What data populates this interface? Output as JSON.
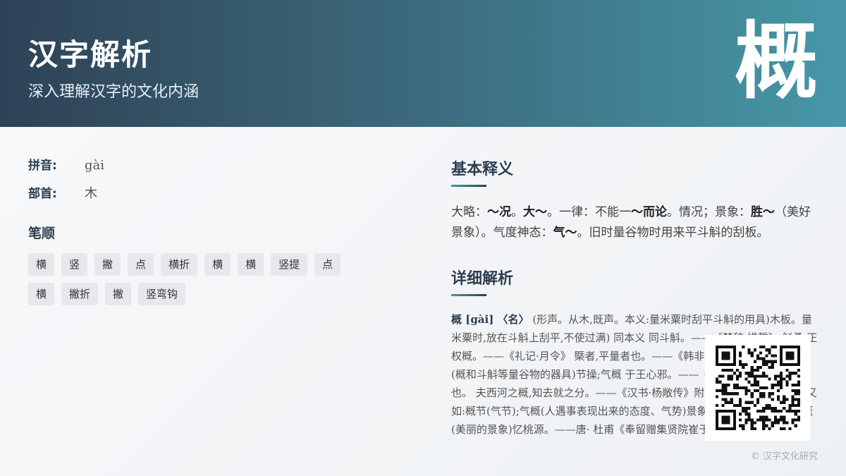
{
  "header": {
    "title": "汉字解析",
    "subtitle": "深入理解汉字的文化内涵",
    "character": "概"
  },
  "info": {
    "pinyin_label": "拼音:",
    "pinyin_value": "gài",
    "radical_label": "部首:",
    "radical_value": "木"
  },
  "strokes": {
    "title": "笔顺",
    "items": [
      "横",
      "竖",
      "撇",
      "点",
      "横折",
      "横",
      "横",
      "竖提",
      "点",
      "横",
      "撇折",
      "撇",
      "竖弯钩"
    ]
  },
  "basic": {
    "title": "基本释义",
    "segments": [
      {
        "t": "大略：",
        "b": false
      },
      {
        "t": "～况",
        "b": true
      },
      {
        "t": "。",
        "b": false
      },
      {
        "t": "大～",
        "b": true
      },
      {
        "t": "。一律：不能一",
        "b": false
      },
      {
        "t": "～而论",
        "b": true
      },
      {
        "t": "。情况；景象：",
        "b": false
      },
      {
        "t": "胜～",
        "b": true
      },
      {
        "t": "（美好景象）。气度神态：",
        "b": false
      },
      {
        "t": "气～",
        "b": true
      },
      {
        "t": "。旧时量谷物时用来平斗斛的刮板。",
        "b": false
      }
    ]
  },
  "detail": {
    "title": "详细解析",
    "head": "概 [gài] 〈名〉",
    "body": "(形声。从木,既声。本义:量米粟时刮平斗斛的用具)木板。量米粟时,放在斗斛上刮平,不使过满) 同本义 同斗斛。——《楚辞·惜誓》 斛甬,正权概。——《礼记·月令》 槩者,平量者也。——《韩非子·外储说》 又如:概量(概和斗斛等量谷物的器具)节操;气概 于王心邪。——《史记·范雎传》。按,平也。 夫西河之概,知去就之分。——《汉书·杨敞传》附 杨恽《报孙会宗书》 又如:概节(气节);气概(人遇事表现出来的态度、气势)景象;状况 故山多药物,胜概(美丽的景象)忆桃源。——唐· 杜甫《奉留赠集贤院崔于二学士》"
  },
  "footer": {
    "copyright": "© 汉字文化研究"
  },
  "qr": {
    "icon": "qr-code-icon"
  }
}
